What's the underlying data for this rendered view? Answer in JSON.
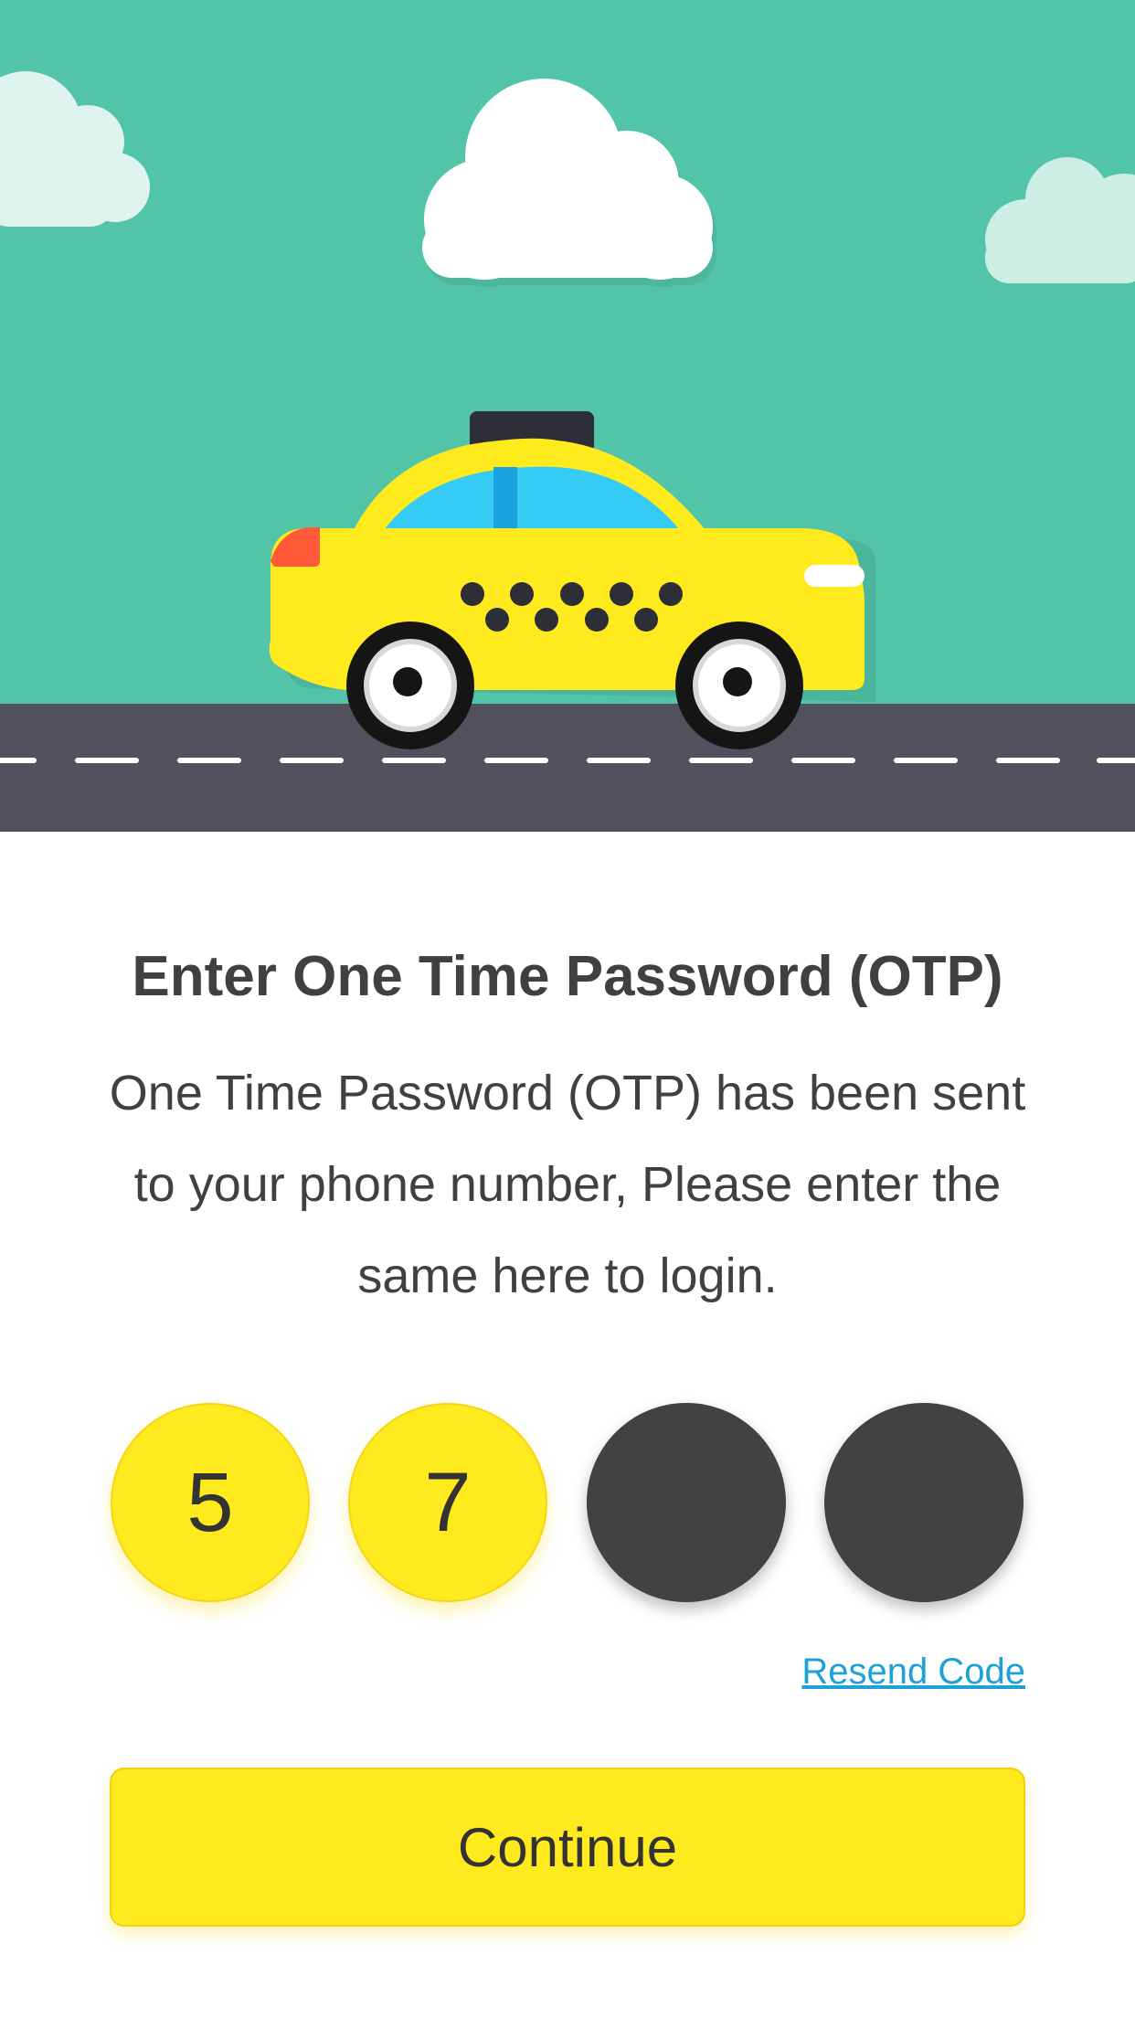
{
  "colors": {
    "sky": "#52c4a8",
    "road": "#52505c",
    "road_marking": "#ffffff",
    "taxi_body": "#ffea1e",
    "taxi_window": "#35cbf5",
    "accent_yellow": "#ffea1e",
    "empty_digit": "#424242",
    "link": "#1ea2d6",
    "text": "#404040"
  },
  "hero": {
    "illustration": "taxi-on-road",
    "icons": [
      "cloud-icon",
      "taxi-icon",
      "road-icon"
    ]
  },
  "title": "Enter One Time Password (OTP)",
  "description": "One Time Password (OTP) has been sent to your phone number, Please enter the same here to login.",
  "otp": {
    "digits": [
      "5",
      "7",
      "",
      ""
    ],
    "length": 4
  },
  "resend_label": "Resend Code",
  "continue_label": "Continue"
}
